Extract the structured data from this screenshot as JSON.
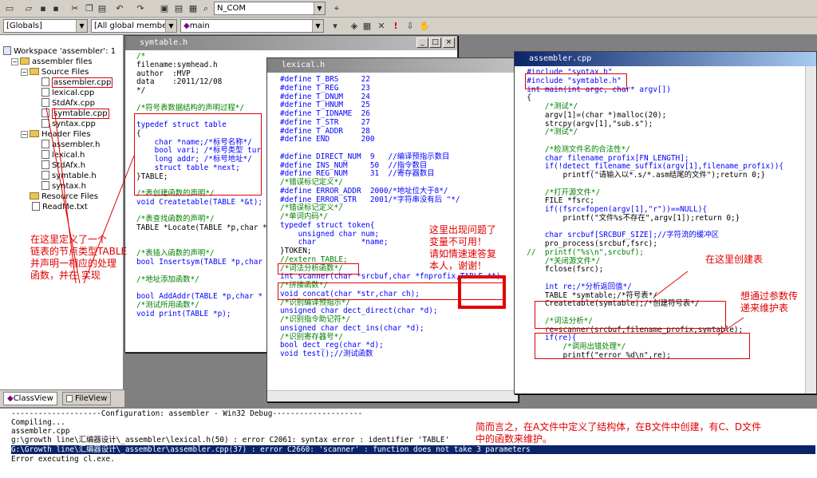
{
  "toolbar": {
    "combo_project": "N_COM",
    "combo_scope": "[Globals]",
    "combo_members": "[All global members",
    "combo_function": "main"
  },
  "workspace": {
    "items": [
      {
        "label": "Workspace 'assembler': 1"
      },
      {
        "label": "assembler files"
      },
      {
        "label": "Source Files"
      },
      {
        "label": "assembler.cpp"
      },
      {
        "label": "lexical.cpp"
      },
      {
        "label": "StdAfx.cpp"
      },
      {
        "label": "symtable.cpp"
      },
      {
        "label": "syntax.cpp"
      },
      {
        "label": "Header Files"
      },
      {
        "label": "assembler.h"
      },
      {
        "label": "lexical.h"
      },
      {
        "label": "StdAfx.h"
      },
      {
        "label": "symtable.h"
      },
      {
        "label": "syntax.h"
      },
      {
        "label": "Resource Files"
      },
      {
        "label": "ReadMe.txt"
      }
    ],
    "tab_classview": "ClassView",
    "tab_fileview": "FileView"
  },
  "win_symtable": {
    "title": "symtable.h",
    "lines": [
      "/*",
      "filename:symhead.h",
      "author  :MVP",
      "data    :2011/12/08",
      "*/",
      "",
      "/*符号表数据结构的声明过程*/",
      "",
      "typedef struct table",
      "{",
      "    char *name;/*标号名称*/",
      "    bool vari; /*标号类型 tur",
      "    long addr; /*标号地址*/",
      "    struct table *next;",
      "}TABLE;",
      "",
      "/*表创建函数的声明*/",
      "void Createtable(TABLE *&t);",
      "",
      "/*表查找函数的声明*/",
      "TABLE *Locate(TABLE *p,char *",
      "",
      "",
      "/*表插入函数的声明*/",
      "bool Insertsym(TABLE *p,char",
      "",
      "/*地址添加函数*/",
      "",
      "bool AddAddr(TABLE *p,char *",
      "/*测试所用函数*/",
      "void print(TABLE *p);"
    ]
  },
  "win_lexical": {
    "title": "lexical.h",
    "lines": [
      "#define T_BRS     22",
      "#define T_REG     23",
      "#define T_DNUM    24",
      "#define T_HNUM    25",
      "#define T_IDNAME  26",
      "#define T_STR     27",
      "#define T_ADDR    28",
      "#define END       200",
      "",
      "#define DIRECT_NUM  9   //编译预指示数目",
      "#define INS_NUM     50  //指令数目",
      "#define REG_NUM     31  //寄存器数目",
      "/*错误标记定义*/",
      "#define ERROR_ADDR  2000/*地址位大于8*/",
      "#define ERROR_STR   2001/*字符串没有后 \"*/",
      "/*错误标记定义*/",
      "/*单词内码*/",
      "typedef struct token{",
      "    unsigned char num;",
      "    char          *name;",
      "}TOKEN;",
      "//extern TABLE;",
      "/*词法分析函数*/",
      "int scanner(char *srcbuf,char *fnprofix,TABLE *t)",
      "/*拼接函数*/",
      "void concat(char *str,char ch);",
      "/*识别编译预指示*/",
      "unsigned char dect_direct(char *d);",
      "/*识别指令助记符*/",
      "unsigned char dect_ins(char *d);",
      "/*识别寄存器号*/",
      "bool dect_reg(char *d);",
      "void test();//测试函数"
    ]
  },
  "win_assembler": {
    "title": "assembler.cpp",
    "lines": [
      "  #include \"syntax.h\"",
      "  #include \"symtable.h\"",
      "  int main(int argc, char* argv[])",
      "  {",
      "      /*测试*/",
      "      argv[1]=(char *)malloc(20);",
      "      strcpy(argv[1],\"sub.s\");",
      "      /*测试*/",
      "",
      "      /*检测文件名的合法性*/",
      "      char filename_profix[FN_LENGTH];",
      "      if(!detect_filename_suffix(argv[1],filename_profix)){",
      "          printf(\"请输入以*.s/*.asm结尾的文件\");return 0;}",
      "",
      "      /*打开源文件*/",
      "      FILE *fsrc;",
      "      if((fsrc=fopen(argv[1],\"r\"))==NULL){",
      "          printf(\"文件%s不存在\",argv[1]);return 0;}",
      "",
      "      char srcbuf[SRCBUF_SIZE];//字符流的缓冲区",
      "      pro_process(srcbuf,fsrc);",
      "  //  printf(\"%s\\n\",srcbuf);",
      "      /*关闭源文件*/",
      "      fclose(fsrc);",
      "",
      "      int re;/*分析返回值*/",
      "      TABLE *symtable;/*符号表*/",
      "      Createtable(symtable);/*创建符号表*/",
      "",
      "      /*词法分析*/",
      "      re=scanner(srcbuf,filename_profix,symtable);",
      "      if(re){",
      "          /*调用出错处理*/",
      "          printf(\"error %d\\n\",re);"
    ]
  },
  "annotations": {
    "left_note": "在这里定义了一个\n链表的节点类型TABLE\n并声明一相应的处理\n函数，并在 实现",
    "middle_note": "这里出现问题了\n变量不可用！\n请如情速速答复\n本人，谢谢！",
    "create_note": "在这里创建表",
    "pass_note": "想通过参数传\n递来维护表",
    "summary_note": "简而言之，在A文件中定义了结构体，在B文件中创建，有C、D文件\n中的函数来维护。"
  },
  "output": {
    "lines": [
      "--------------------Configuration: assembler - Win32 Debug--------------------",
      "Compiling...",
      "assembler.cpp",
      "g:\\growth line\\汇编器设计\\_assembler\\lexical.h(50) : error C2061: syntax error : identifier 'TABLE'",
      "G:\\Growth line\\汇编器设计\\_assembler\\assembler.cpp(37) : error C2660: 'scanner' : function does not take 3 parameters",
      "Error executing cl.exe."
    ]
  }
}
